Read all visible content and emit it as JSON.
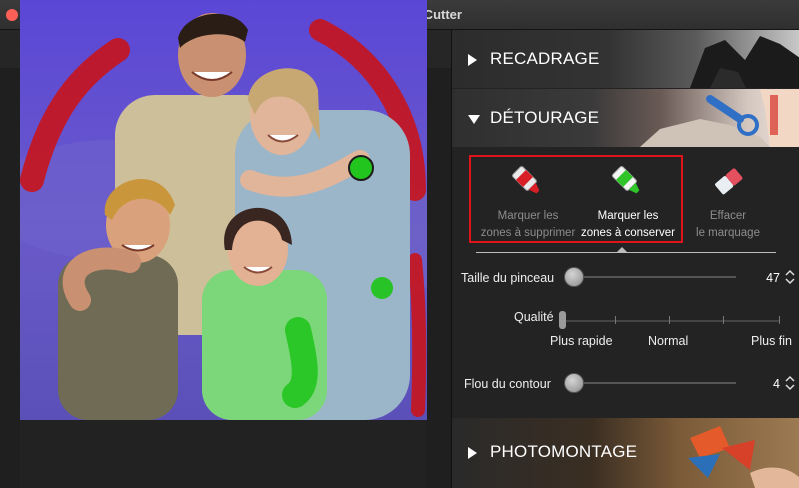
{
  "window": {
    "title": "inPixio Photo Cutter"
  },
  "toolbar": {
    "undo_icon": "undo-icon",
    "redo_icon": "redo-icon",
    "save_icon": "save-icon"
  },
  "sections": {
    "recadrage": {
      "label": "RECADRAGE",
      "expanded": false
    },
    "detourage": {
      "label": "DÉTOURAGE",
      "expanded": true
    },
    "photomontage": {
      "label": "PHOTOMONTAGE",
      "expanded": false
    }
  },
  "tools": [
    {
      "line1": "Marquer les",
      "line2": "zones à supprimer",
      "icon": "red-marker-icon",
      "active": false
    },
    {
      "line1": "Marquer les",
      "line2": "zones à conserver",
      "icon": "green-marker-icon",
      "active": true
    },
    {
      "line1": "Effacer",
      "line2": "le marquage",
      "icon": "eraser-icon",
      "active": false
    }
  ],
  "brush_size": {
    "label": "Taille du pinceau",
    "value": "47"
  },
  "quality": {
    "label": "Qualité",
    "options": [
      "Plus rapide",
      "Normal",
      "Plus fin"
    ],
    "selected": "Plus rapide"
  },
  "edge_blur": {
    "label": "Flou du contour",
    "value": "4"
  },
  "colors": {
    "accent": "#3b7cd6",
    "remove_mark": "#c8141c",
    "keep_mark": "#22c41e",
    "highlight_box": "#e0141b",
    "overlay": "#4a3fd8"
  }
}
